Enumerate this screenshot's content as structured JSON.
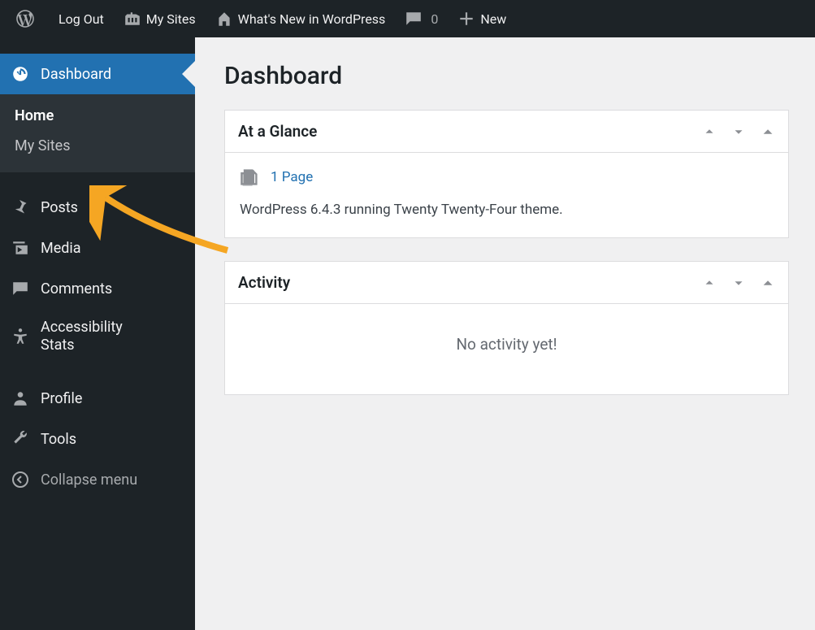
{
  "adminbar": {
    "logout": "Log Out",
    "mysites": "My Sites",
    "sitename": "What's New in WordPress",
    "comments_count": "0",
    "new": "New"
  },
  "sidebar": {
    "dashboard": "Dashboard",
    "sub_home": "Home",
    "sub_mysites": "My Sites",
    "posts": "Posts",
    "media": "Media",
    "comments": "Comments",
    "a11y": "Accessibility Stats",
    "profile": "Profile",
    "tools": "Tools",
    "collapse": "Collapse menu"
  },
  "page": {
    "title": "Dashboard"
  },
  "glance": {
    "heading": "At a Glance",
    "pages": "1 Page",
    "status": "WordPress 6.4.3 running Twenty Twenty-Four theme."
  },
  "activity": {
    "heading": "Activity",
    "empty": "No activity yet!"
  }
}
